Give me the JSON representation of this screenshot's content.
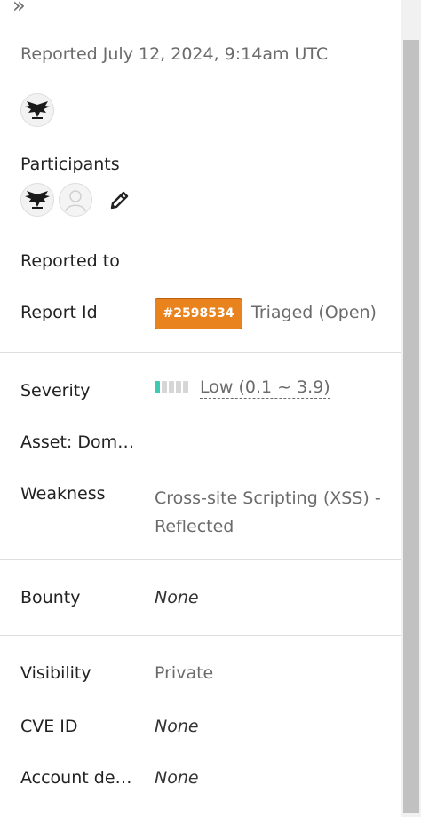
{
  "header": {
    "collapse_icon": "double-chevron-right-icon",
    "reported_at": "Reported July 12, 2024, 9:14am UTC"
  },
  "reporter": {
    "avatar": "hacker-avatar"
  },
  "participants": {
    "label": "Participants",
    "edit_icon": "pencil-icon"
  },
  "details": {
    "reported_to_label": "Reported to",
    "report_id_label": "Report Id",
    "report_id": "#2598534",
    "status": "Triaged (Open)",
    "severity_label": "Severity",
    "severity_value": "Low (0.1 ~ 3.9)",
    "severity_level": 1,
    "severity_levels_total": 5,
    "asset_label": "Asset: Dom…",
    "weakness_label": "Weakness",
    "weakness_value": "Cross-site Scripting (XSS) - Reflected",
    "bounty_label": "Bounty",
    "bounty_value": "None",
    "visibility_label": "Visibility",
    "visibility_value": "Private",
    "cve_label": "CVE ID",
    "cve_value": "None",
    "account_label": "Account de…",
    "account_value": "None"
  },
  "colors": {
    "badge_bg": "#e8831e",
    "severity_low": "#3ccbb0",
    "muted_text": "#6b6b6b"
  }
}
